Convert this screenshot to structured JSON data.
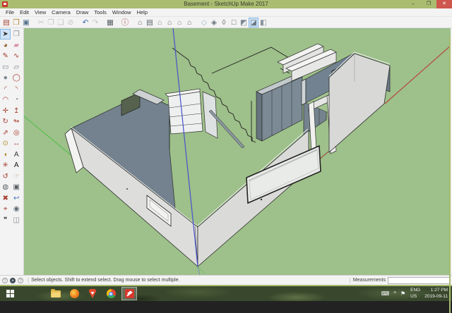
{
  "window": {
    "title": "Basement - SketchUp Make 2017",
    "minimize_label": "–",
    "maximize_label": "❐",
    "close_label": "✕"
  },
  "menu_bar": {
    "items": [
      "File",
      "Edit",
      "View",
      "Camera",
      "Draw",
      "Tools",
      "Window",
      "Help"
    ]
  },
  "toolbar": {
    "buttons": [
      {
        "name": "new",
        "glyph": "▤",
        "color": "#a8493c",
        "group": 1
      },
      {
        "name": "open",
        "glyph": "❒",
        "color": "#b5862b",
        "group": 1
      },
      {
        "name": "save",
        "glyph": "▣",
        "color": "#56748f",
        "group": 1
      },
      {
        "name": "cut",
        "glyph": "✂",
        "color": "#9a9a9a",
        "group": 2,
        "disabled": true
      },
      {
        "name": "copy",
        "glyph": "❐",
        "color": "#9a9a9a",
        "group": 2,
        "disabled": true
      },
      {
        "name": "paste",
        "glyph": "❏",
        "color": "#9a9a9a",
        "group": 2,
        "disabled": true
      },
      {
        "name": "erase",
        "glyph": "⊘",
        "color": "#9a9a9a",
        "group": 2,
        "disabled": true
      },
      {
        "name": "undo",
        "glyph": "↶",
        "color": "#3d6db5",
        "group": 3
      },
      {
        "name": "redo",
        "glyph": "↷",
        "color": "#9a9a9a",
        "group": 3,
        "disabled": true
      },
      {
        "name": "print",
        "glyph": "▦",
        "color": "#5a5f63",
        "group": 4
      },
      {
        "name": "model-info",
        "glyph": "ⓘ",
        "color": "#a8493c",
        "group": 5
      },
      {
        "name": "iso-view",
        "glyph": "⌂",
        "color": "#5f656a",
        "group": 6
      },
      {
        "name": "top-view",
        "glyph": "▤",
        "color": "#5f656a",
        "group": 6
      },
      {
        "name": "front-view",
        "glyph": "⌂",
        "color": "#81878c",
        "group": 6
      },
      {
        "name": "right-view",
        "glyph": "⌂",
        "color": "#5f656a",
        "group": 6
      },
      {
        "name": "back-view",
        "glyph": "⌂",
        "color": "#81878c",
        "group": 6
      },
      {
        "name": "left-view",
        "glyph": "⌂",
        "color": "#5f656a",
        "group": 6
      },
      {
        "name": "x-ray-style",
        "glyph": "◇",
        "color": "#9fb2c4",
        "group": 7
      },
      {
        "name": "back-edges-style",
        "glyph": "◈",
        "color": "#6b7480",
        "group": 7
      },
      {
        "name": "wireframe-style",
        "glyph": "◊",
        "color": "#5f656a",
        "group": 7
      },
      {
        "name": "hidden-line-style",
        "glyph": "□",
        "color": "#5f656a",
        "group": 7
      },
      {
        "name": "shaded-style",
        "glyph": "◩",
        "color": "#7c8893",
        "group": 7
      },
      {
        "name": "shaded-textures-style",
        "glyph": "◪",
        "color": "#6d7984",
        "group": 7,
        "active": true
      },
      {
        "name": "monochrome-style",
        "glyph": "◧",
        "color": "#8b949b",
        "group": 7
      }
    ]
  },
  "tool_palette": {
    "rows": [
      [
        {
          "name": "select",
          "glyph": "➤",
          "color": "#2f2f2f",
          "active": true
        },
        {
          "name": "make-component",
          "glyph": "❒",
          "color": "#8a9097"
        }
      ],
      [
        {
          "name": "paint-bucket",
          "glyph": "◕",
          "color": "#8a5a2a"
        },
        {
          "name": "eraser",
          "glyph": "▰",
          "color": "#d892a8"
        }
      ],
      [
        {
          "name": "line",
          "glyph": "✎",
          "color": "#a63c30"
        },
        {
          "name": "freehand",
          "glyph": "∿",
          "color": "#a63c30"
        }
      ],
      [
        {
          "name": "rectangle",
          "glyph": "▭",
          "color": "#6f7b85"
        },
        {
          "name": "rotated-rectangle",
          "glyph": "▱",
          "color": "#6f7b85"
        }
      ],
      [
        {
          "name": "circle",
          "glyph": "●",
          "color": "#76828c"
        },
        {
          "name": "polygon",
          "glyph": "◯",
          "color": "#a63c30"
        }
      ],
      [
        {
          "name": "arc",
          "glyph": "◜",
          "color": "#a63c30"
        },
        {
          "name": "two-point-arc",
          "glyph": "◝",
          "color": "#a63c30"
        }
      ],
      [
        {
          "name": "three-point-arc",
          "glyph": "◠",
          "color": "#a63c30"
        },
        {
          "name": "pie",
          "glyph": "◔",
          "color": "#76828c"
        }
      ],
      [
        {
          "name": "move",
          "glyph": "✛",
          "color": "#a63c30"
        },
        {
          "name": "push-pull",
          "glyph": "↥",
          "color": "#a63c30"
        }
      ],
      [
        {
          "name": "rotate",
          "glyph": "↻",
          "color": "#a63c30"
        },
        {
          "name": "follow-me",
          "glyph": "↬",
          "color": "#a63c30"
        }
      ],
      [
        {
          "name": "scale",
          "glyph": "⇗",
          "color": "#a63c30"
        },
        {
          "name": "offset",
          "glyph": "◎",
          "color": "#a63c30"
        }
      ],
      [
        {
          "name": "tape-measure",
          "glyph": "⊙",
          "color": "#b08a2e"
        },
        {
          "name": "dimension",
          "glyph": "↔",
          "color": "#a63c30"
        }
      ],
      [
        {
          "name": "protractor",
          "glyph": "◖",
          "color": "#b08a2e"
        },
        {
          "name": "text",
          "glyph": "A",
          "color": "#3a3a3a"
        }
      ],
      [
        {
          "name": "axes",
          "glyph": "✳",
          "color": "#a63c30"
        },
        {
          "name": "3d-text",
          "glyph": "A",
          "color": "#17171a"
        }
      ],
      [
        {
          "name": "orbit",
          "glyph": "↺",
          "color": "#a63c30"
        },
        {
          "name": "pan",
          "glyph": "☞",
          "color": "#b99a6f"
        }
      ],
      [
        {
          "name": "zoom",
          "glyph": "◍",
          "color": "#5a6066"
        },
        {
          "name": "zoom-window",
          "glyph": "▣",
          "color": "#5a6066"
        }
      ],
      [
        {
          "name": "zoom-extents",
          "glyph": "✖",
          "color": "#a63c30"
        },
        {
          "name": "zoom-previous",
          "glyph": "↩",
          "color": "#3d6db5"
        }
      ],
      [
        {
          "name": "position-camera",
          "glyph": "⌖",
          "color": "#a63c30"
        },
        {
          "name": "look-around",
          "glyph": "◉",
          "color": "#5f6b74"
        }
      ],
      [
        {
          "name": "walk",
          "glyph": "❞",
          "color": "#3a3a3a"
        },
        {
          "name": "section-plane",
          "glyph": "◫",
          "color": "#848b92"
        }
      ]
    ]
  },
  "viewport": {
    "background": "#9ec08a",
    "axis_colors": {
      "red": "#b5493f",
      "green": "#58c052",
      "blue": "#4652cc"
    }
  },
  "status_bar": {
    "message": "Select objects. Shift to extend select. Drag mouse to select multiple.",
    "separator": "|",
    "measurements_label": "Measurements",
    "measurements_value": ""
  },
  "taskbar": {
    "apps": [
      {
        "name": "start"
      },
      {
        "name": "file-explorer"
      },
      {
        "name": "firefox"
      },
      {
        "name": "brave"
      },
      {
        "name": "chrome"
      },
      {
        "name": "sketchup",
        "active": true
      }
    ],
    "tray": {
      "keyboard_icon": "⌨",
      "hidden_icons_caret": "^",
      "flag_icon": "⚑",
      "language": "ENG",
      "region": "US",
      "time": "1:27 PM",
      "date": "2019-09-11"
    }
  }
}
